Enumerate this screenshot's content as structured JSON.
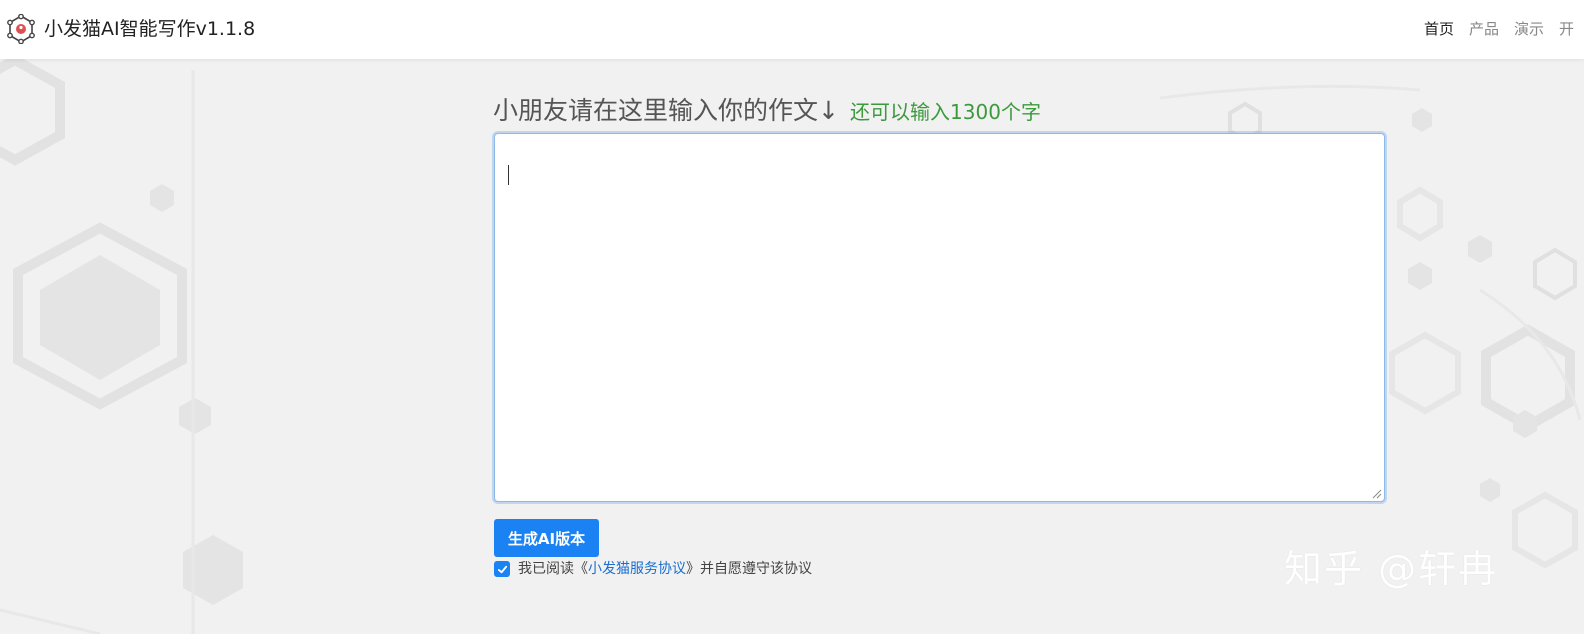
{
  "header": {
    "app_title": "小发猫AI智能写作v1.1.8",
    "nav": [
      {
        "label": "首页",
        "active": true
      },
      {
        "label": "产品",
        "active": false
      },
      {
        "label": "演示",
        "active": false
      },
      {
        "label": "开",
        "active": false
      }
    ]
  },
  "main": {
    "heading": "小朋友请在这里输入你的作文↓",
    "remaining_text": "还可以输入1300个字",
    "essay_value": "",
    "generate_label": "生成AI版本",
    "agreement": {
      "checked": true,
      "prefix": "我已阅读《",
      "link_text": "小发猫服务协议",
      "suffix": "》并自愿遵守该协议"
    }
  },
  "watermark": "知乎 @轩冉",
  "colors": {
    "primary": "#1a82f2",
    "remaining_green": "#3c9a3c",
    "link": "#1a6fd1",
    "background": "#f1f1f1"
  },
  "icons": {
    "logo": "hexagon-network-logo-icon",
    "checkbox": "check-icon"
  }
}
